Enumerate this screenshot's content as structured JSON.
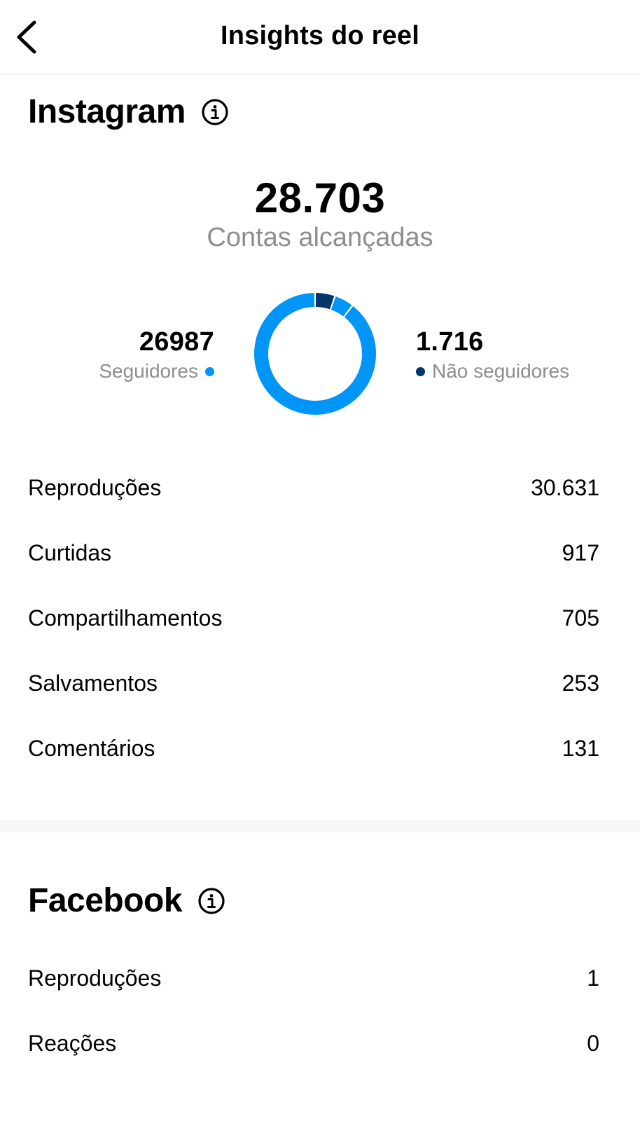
{
  "header": {
    "title": "Insights do reel",
    "back_icon": "chevron-left-icon"
  },
  "instagram": {
    "title": "Instagram",
    "info_icon": "info-icon",
    "reach": {
      "value": "28.703",
      "label": "Contas alcançadas"
    },
    "followers": {
      "value": "26987",
      "label": "Seguidores",
      "color": "#0095f6"
    },
    "non_followers": {
      "value": "1.716",
      "label": "Não seguidores",
      "color": "#00376b"
    },
    "donut": {
      "segments": [
        {
          "name": "non_followers_primary",
          "fraction": 0.053,
          "color": "#00376b"
        },
        {
          "name": "non_followers_secondary",
          "fraction": 0.052,
          "color": "#0095f6"
        },
        {
          "name": "followers",
          "fraction": 0.895,
          "color": "#0095f6"
        }
      ]
    },
    "metrics": [
      {
        "label": "Reproduções",
        "value": "30.631"
      },
      {
        "label": "Curtidas",
        "value": "917"
      },
      {
        "label": "Compartilhamentos",
        "value": "705"
      },
      {
        "label": "Salvamentos",
        "value": "253"
      },
      {
        "label": "Comentários",
        "value": "131"
      }
    ]
  },
  "facebook": {
    "title": "Facebook",
    "info_icon": "info-icon",
    "metrics": [
      {
        "label": "Reproduções",
        "value": "1"
      },
      {
        "label": "Reações",
        "value": "0"
      }
    ]
  }
}
